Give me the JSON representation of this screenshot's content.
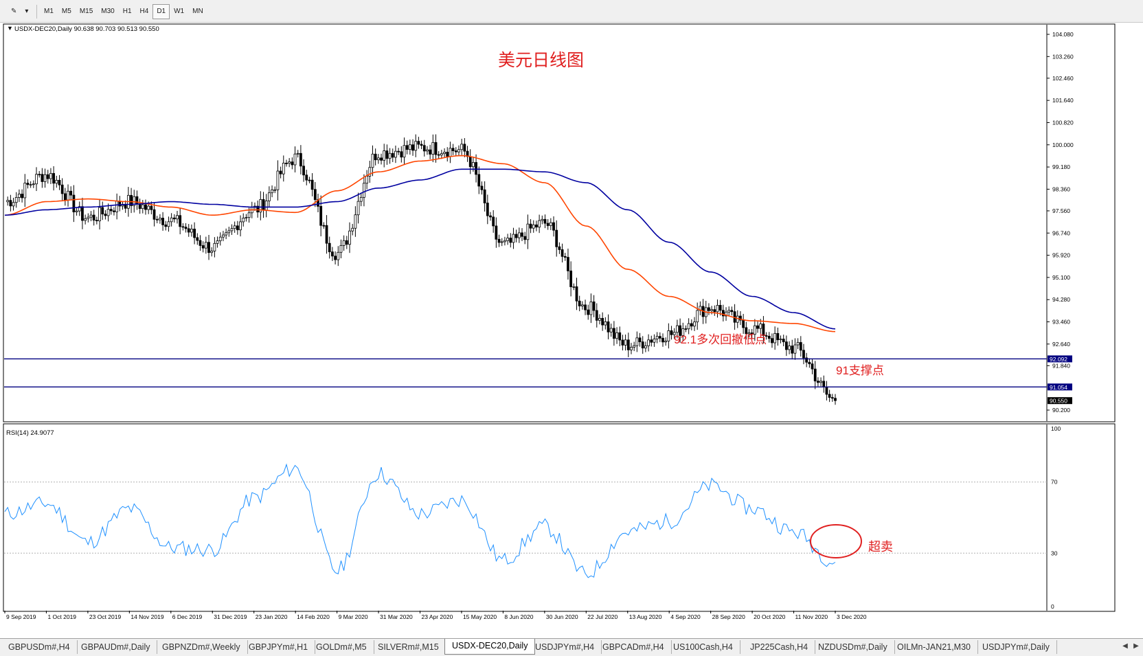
{
  "toolbar": {
    "timeframes": [
      "M1",
      "M5",
      "M15",
      "M30",
      "H1",
      "H4",
      "D1",
      "W1",
      "MN"
    ],
    "active_timeframe": "D1"
  },
  "chart": {
    "symbol_info": "USDX-DEC20,Daily  90.638 90.703 90.513 90.550",
    "annotation_title": "美元日线图",
    "annotation_support1": "92.1多次回撤低点",
    "annotation_support2": "91支撑点",
    "annotation_oversold": "超卖",
    "indicator_label": "RSI(14) 24.9077",
    "price_axis_ticks": [
      "104.080",
      "103.260",
      "102.460",
      "101.640",
      "100.820",
      "100.000",
      "99.180",
      "98.360",
      "97.560",
      "96.740",
      "95.920",
      "95.100",
      "94.280",
      "93.460",
      "92.640",
      "91.840",
      "90.200"
    ],
    "price_markers": [
      {
        "label": "92.092",
        "value": 92.092,
        "color": "#000080"
      },
      {
        "label": "91.054",
        "value": 91.054,
        "color": "#000080"
      },
      {
        "label": "90.550",
        "value": 90.55,
        "color": "#000000"
      }
    ],
    "rsi_axis_ticks": [
      "100",
      "70",
      "30",
      "0"
    ],
    "time_axis_labels": [
      "9 Sep 2019",
      "1 Oct 2019",
      "23 Oct 2019",
      "14 Nov 2019",
      "6 Dec 2019",
      "31 Dec 2019",
      "23 Jan 2020",
      "14 Feb 2020",
      "9 Mar 2020",
      "31 Mar 2020",
      "23 Apr 2020",
      "15 May 2020",
      "8 Jun 2020",
      "30 Jun 2020",
      "22 Jul 2020",
      "13 Aug 2020",
      "4 Sep 2020",
      "28 Sep 2020",
      "20 Oct 2020",
      "11 Nov 2020",
      "3 Dec 2020"
    ],
    "colors": {
      "candle": "#000000",
      "ma_fast": "#ff4500",
      "ma_slow": "#0000a0",
      "support_line": "#000080",
      "rsi_line": "#1e90ff",
      "annotation": "#e02020"
    }
  },
  "chart_data": [
    {
      "type": "candlestick",
      "title": "USDX-DEC20,Daily",
      "ylim": [
        90.2,
        104.08
      ],
      "x": [
        "9 Sep 2019",
        "1 Oct 2019",
        "23 Oct 2019",
        "14 Nov 2019",
        "6 Dec 2019",
        "31 Dec 2019",
        "23 Jan 2020",
        "14 Feb 2020",
        "9 Mar 2020",
        "31 Mar 2020",
        "23 Apr 2020",
        "15 May 2020",
        "8 Jun 2020",
        "30 Jun 2020",
        "22 Jul 2020",
        "13 Aug 2020",
        "4 Sep 2020",
        "28 Sep 2020",
        "20 Oct 2020",
        "11 Nov 2020",
        "3 Dec 2020"
      ],
      "series": [
        {
          "name": "close",
          "values": [
            97.9,
            98.9,
            97.3,
            97.9,
            97.2,
            96.2,
            97.6,
            99.5,
            96.0,
            99.7,
            99.9,
            99.8,
            96.3,
            97.1,
            94.0,
            92.6,
            93.0,
            94.0,
            93.2,
            92.5,
            90.55
          ]
        },
        {
          "name": "ma_fast",
          "values": [
            97.4,
            97.9,
            98.0,
            97.9,
            97.7,
            97.4,
            97.6,
            97.5,
            98.3,
            99.0,
            99.4,
            99.6,
            99.3,
            98.6,
            97.0,
            95.4,
            94.4,
            93.8,
            93.5,
            93.4,
            93.1
          ]
        },
        {
          "name": "ma_slow",
          "values": [
            97.4,
            97.6,
            97.7,
            97.8,
            97.9,
            97.8,
            97.7,
            97.7,
            97.9,
            98.4,
            98.7,
            99.1,
            99.1,
            99.0,
            98.6,
            97.6,
            96.4,
            95.3,
            94.4,
            93.8,
            93.2
          ]
        }
      ],
      "last": {
        "open": 90.638,
        "high": 90.703,
        "low": 90.513,
        "close": 90.55
      },
      "horizontal_lines": [
        92.092,
        91.054
      ]
    },
    {
      "type": "line",
      "title": "RSI(14) 24.9077",
      "ylim": [
        0,
        100
      ],
      "levels": [
        70,
        30
      ],
      "x": [
        "9 Sep 2019",
        "1 Oct 2019",
        "23 Oct 2019",
        "14 Nov 2019",
        "6 Dec 2019",
        "31 Dec 2019",
        "23 Jan 2020",
        "14 Feb 2020",
        "9 Mar 2020",
        "31 Mar 2020",
        "23 Apr 2020",
        "15 May 2020",
        "8 Jun 2020",
        "30 Jun 2020",
        "22 Jul 2020",
        "13 Aug 2020",
        "4 Sep 2020",
        "28 Sep 2020",
        "20 Oct 2020",
        "11 Nov 2020",
        "3 Dec 2020"
      ],
      "series": [
        {
          "values": [
            52,
            58,
            36,
            55,
            33,
            32,
            61,
            78,
            20,
            75,
            52,
            60,
            26,
            45,
            18,
            42,
            48,
            68,
            55,
            42,
            24.9
          ]
        }
      ]
    }
  ],
  "tabs": {
    "items": [
      "GBPUSDm#,H4",
      "GBPAUDm#,Daily",
      "GBPNZDm#,Weekly",
      "GBPJPYm#,H1",
      "GOLDm#,M5",
      "SILVERm#,M15",
      "USDX-DEC20,Daily",
      "USDJPYm#,H4",
      "GBPCADm#,H4",
      "US100Cash,H4",
      "JP225Cash,H4",
      "NZDUSDm#,Daily",
      "OILMn-JAN21,M30",
      "USDJPYm#,Daily"
    ],
    "active": "USDX-DEC20,Daily",
    "nav_left": "◀",
    "nav_right": "▶"
  }
}
